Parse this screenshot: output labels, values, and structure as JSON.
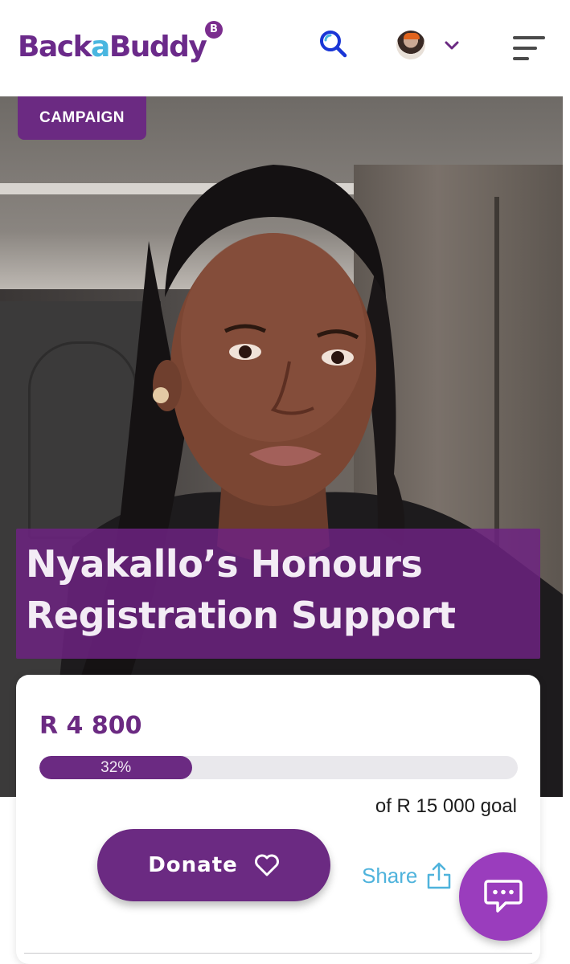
{
  "header": {
    "logo_part1": "Back",
    "logo_part2": "a",
    "logo_part3": "Buddy",
    "logo_badge": "B",
    "icons": [
      "search-icon",
      "avatar",
      "chevron-down-icon",
      "hamburger-menu-icon"
    ]
  },
  "hero": {
    "badge": "CAMPAIGN",
    "title": "Nyakallo’s Honours Registration Support"
  },
  "campaign": {
    "raised": "R 4 800",
    "progress_percent": 32,
    "progress_label": "32%",
    "goal_text": "of R 15 000 goal",
    "donate_label": "Donate",
    "share_label": "Share"
  },
  "colors": {
    "brand_purple": "#6b2a82",
    "accent_blue": "#4fb3dc",
    "chat_purple": "#9a3dbd"
  }
}
